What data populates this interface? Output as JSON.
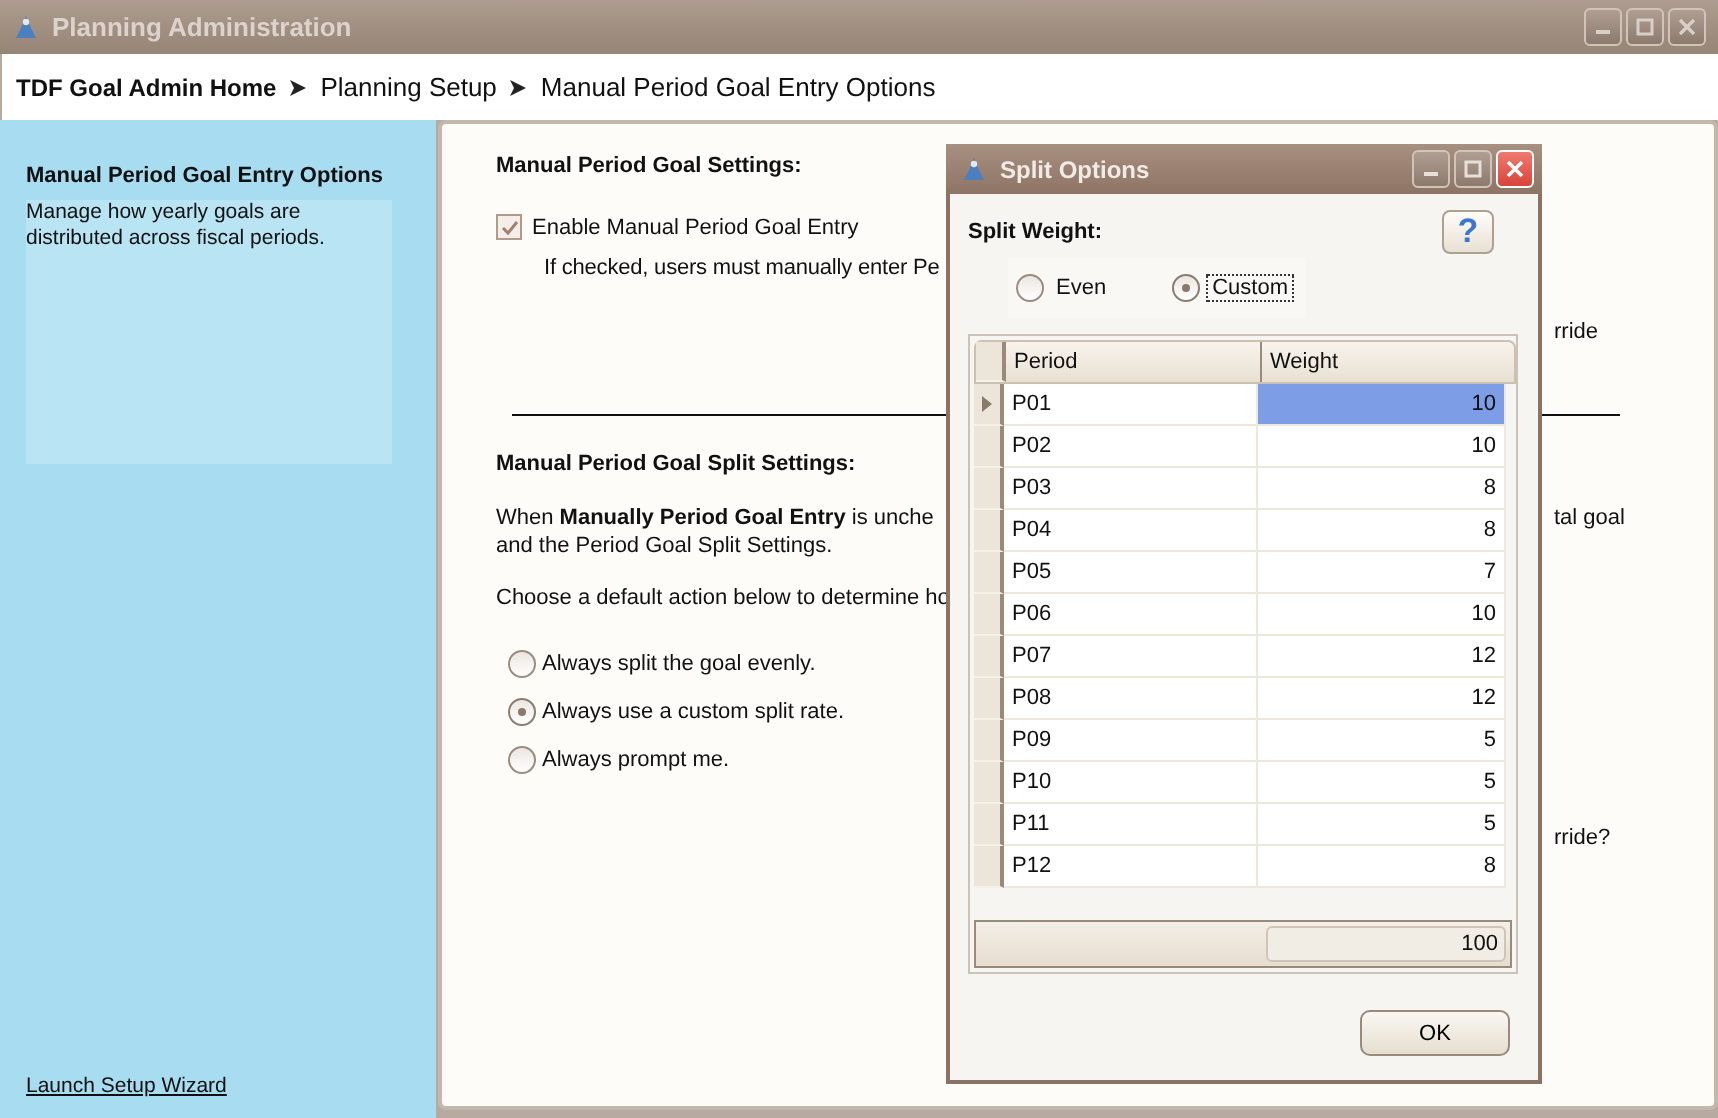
{
  "window": {
    "title": "Planning Administration"
  },
  "breadcrumb": [
    {
      "label": "TDF Goal Admin Home",
      "kind": "home"
    },
    {
      "label": "Planning Setup",
      "kind": "step"
    },
    {
      "label": "Manual Period Goal Entry Options",
      "kind": "step"
    }
  ],
  "sidebar": {
    "title": "Manual Period Goal Entry Options",
    "description": "Manage how yearly goals are distributed across fiscal periods.",
    "link": "Launch Setup Wizard"
  },
  "settings": {
    "heading": "Manual Period Goal Settings:",
    "checkbox": {
      "label": "Enable Manual Period Goal Entry",
      "checked": true
    },
    "note": "If checked, users must manually enter Pe",
    "note_tail": "rride"
  },
  "split_settings": {
    "heading": "Manual Period Goal Split Settings:",
    "paragraph": "When **Manually Period Goal Entry** is unche",
    "paragraph_tail": "tal goal",
    "paragraph_line2": "and the Period Goal Split Settings.",
    "prompt": "Choose a default action below to determine ho",
    "options": [
      {
        "label": "Always split the goal evenly.",
        "selected": false
      },
      {
        "label": "Always use a custom split rate.",
        "selected": true
      },
      {
        "label": "Always prompt me.",
        "selected": false
      }
    ],
    "tail": "rride?"
  },
  "dialog": {
    "title": "Split Options",
    "split_weight_label": "Split Weight:",
    "help": "?",
    "weights": [
      {
        "label": "Even",
        "selected": false
      },
      {
        "label": "Custom",
        "selected": true
      }
    ],
    "columns": [
      "Period",
      "Weight"
    ],
    "rows": [
      {
        "period": "P01",
        "weight": "10",
        "selected": true
      },
      {
        "period": "P02",
        "weight": "10",
        "selected": false
      },
      {
        "period": "P03",
        "weight": "8",
        "selected": false
      },
      {
        "period": "P04",
        "weight": "8",
        "selected": false
      },
      {
        "period": "P05",
        "weight": "7",
        "selected": false
      },
      {
        "period": "P06",
        "weight": "10",
        "selected": false
      },
      {
        "period": "P07",
        "weight": "12",
        "selected": false
      },
      {
        "period": "P08",
        "weight": "12",
        "selected": false
      },
      {
        "period": "P09",
        "weight": "5",
        "selected": false
      },
      {
        "period": "P10",
        "weight": "5",
        "selected": false
      },
      {
        "period": "P11",
        "weight": "5",
        "selected": false
      },
      {
        "period": "P12",
        "weight": "8",
        "selected": false
      }
    ],
    "total": "100",
    "ok": "OK"
  }
}
